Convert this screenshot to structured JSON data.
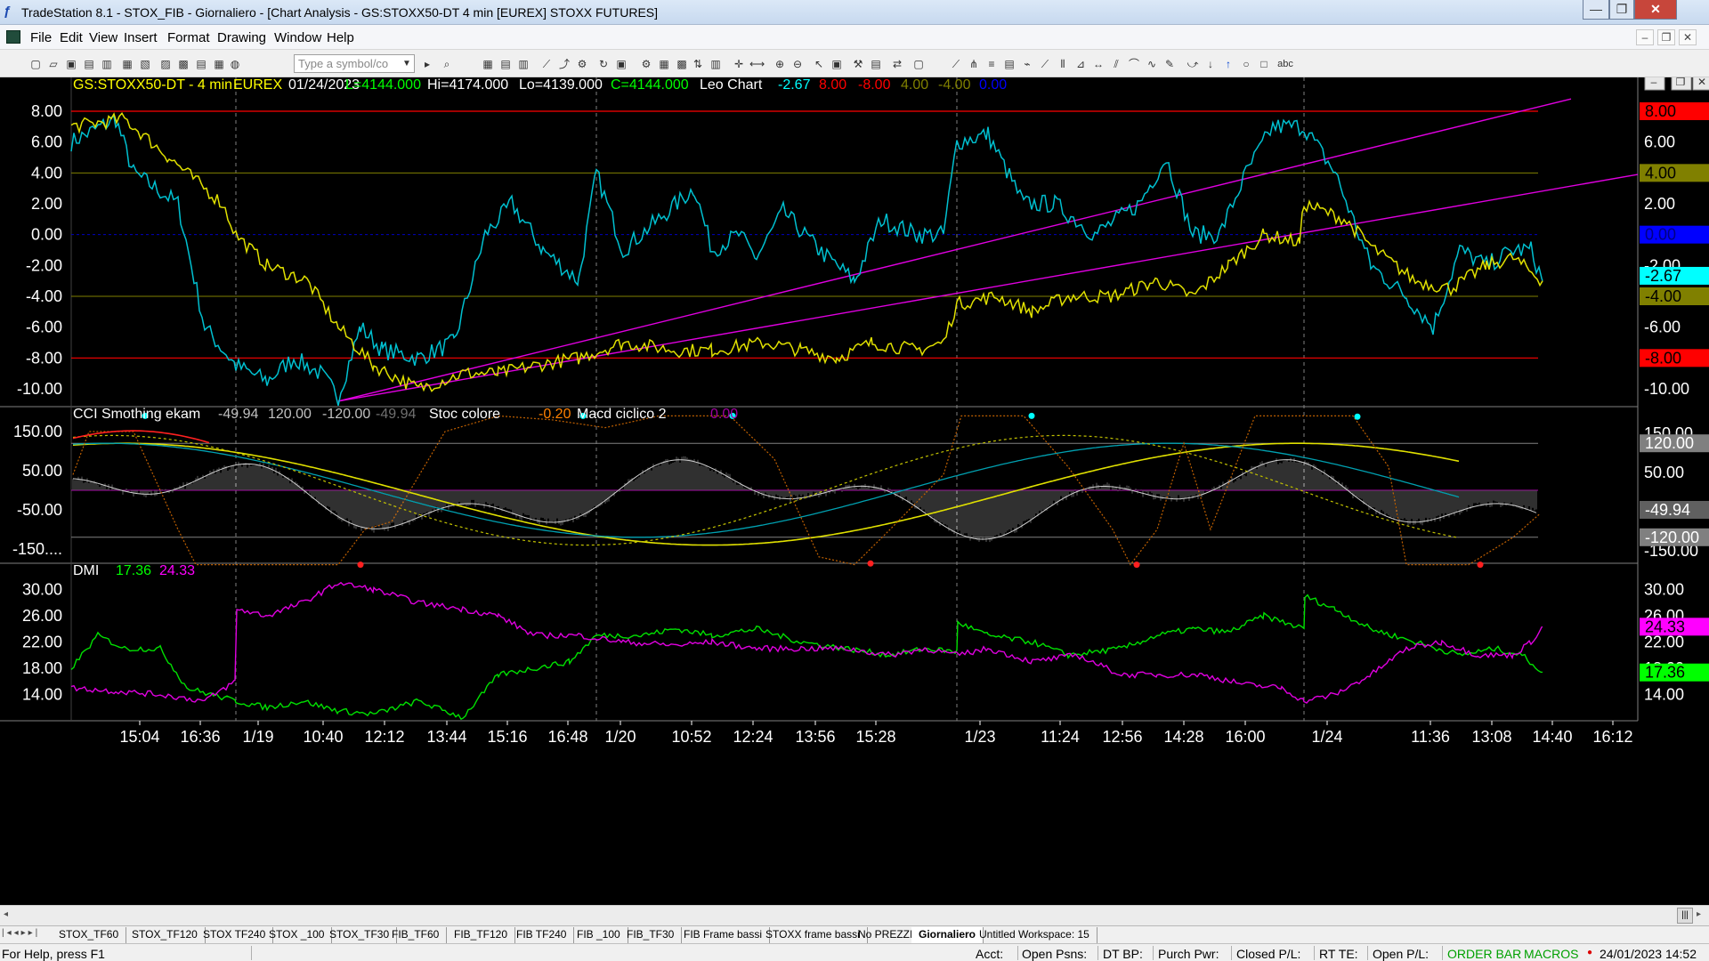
{
  "window": {
    "title": "TradeStation 8.1 - STOX_FIB - Giornaliero - [Chart Analysis - GS:STOXX50-DT  4 min  [EUREX] STOXX FUTURES]",
    "min": "—",
    "max": "❐",
    "close": "✕"
  },
  "menu": [
    "File",
    "Edit",
    "View",
    "Insert",
    "Format",
    "Drawing",
    "Window",
    "Help"
  ],
  "toolbar": {
    "symbol_placeholder": "Type a symbol/co"
  },
  "price_header": {
    "symbol": "GS:STOXX50-DT - 4 min",
    "exchange": "EUREX",
    "date": "01/24/2023",
    "last": "L=4144.000",
    "high": "Hi=4174.000",
    "low": "Lo=4139.000",
    "close": "C=4144.000",
    "study": "Leo Chart",
    "v1": "-2.67",
    "v2": "8.00",
    "v3": "-8.00",
    "v4": "4.00",
    "v5": "-4.00",
    "v6": "0.00"
  },
  "cci_header": {
    "name": "CCI Smothing ekam",
    "v1": "-49.94",
    "v2": "120.00",
    "v3": "-120.00",
    "v4": "-49.94",
    "stoc": "Stoc colore",
    "stoc_v": "-0.20",
    "macd": "Macd ciclico 2",
    "macd_v": "0.00"
  },
  "dmi_header": {
    "name": "DMI",
    "v1": "17.36",
    "v2": "24.33"
  },
  "panel1_left_ticks": [
    "8.00",
    "6.00",
    "4.00",
    "2.00",
    "0.00",
    "-2.00",
    "-4.00",
    "-6.00",
    "-8.00",
    "-10.00"
  ],
  "panel1_right_ticks": [
    "8.00",
    "6.00",
    "4.00",
    "2.00",
    "0.00",
    "-2.00",
    "-4.00",
    "-6.00",
    "-8.00",
    "-10.00"
  ],
  "panel1_right_labels": [
    {
      "text": "8.00",
      "color": "#ff0000",
      "fg": "#000000"
    },
    {
      "text": "4.00",
      "color": "#808000",
      "fg": "#000000"
    },
    {
      "text": "0.00",
      "color": "#0000ff",
      "fg": "#000080"
    },
    {
      "text": "-2.67",
      "color": "#00ffff",
      "fg": "#000000"
    },
    {
      "text": "-4.00",
      "color": "#808000",
      "fg": "#000000"
    },
    {
      "text": "-8.00",
      "color": "#ff0000",
      "fg": "#000000"
    }
  ],
  "panel2_left_ticks": [
    "150.00",
    "50.00",
    "-50.00",
    "-150...."
  ],
  "panel2_right_ticks": [
    "150.00",
    "50.00",
    "-150.00"
  ],
  "panel2_right_labels": [
    {
      "text": "120.00",
      "color": "#808080",
      "fg": "#ffffff"
    },
    {
      "text": "-49.94",
      "color": "#606060",
      "fg": "#ffffff"
    },
    {
      "text": "-120.00",
      "color": "#808080",
      "fg": "#ffffff"
    }
  ],
  "panel3_left_ticks": [
    "30.00",
    "26.00",
    "22.00",
    "18.00",
    "14.00"
  ],
  "panel3_right_ticks": [
    "30.00",
    "26.00",
    "22.00",
    "18.00",
    "14.00"
  ],
  "panel3_right_labels": [
    {
      "text": "24.33",
      "color": "#ff00ff",
      "fg": "#000000"
    },
    {
      "text": "17.36",
      "color": "#00ff00",
      "fg": "#000000"
    }
  ],
  "time_axis": [
    "15:04",
    "16:36",
    "1/19",
    "10:40",
    "12:12",
    "13:44",
    "15:16",
    "16:48",
    "1/20",
    "10:52",
    "12:24",
    "13:56",
    "15:28",
    "1/23",
    "11:24",
    "12:56",
    "14:28",
    "16:00",
    "1/24",
    "11:36",
    "13:08",
    "14:40",
    "16:12"
  ],
  "colors": {
    "cci_cyan": "#00c0d0",
    "cci_yellow": "#e0e000",
    "trend": "#e000e0",
    "red_line": "#ff0000",
    "olive_line": "#808000",
    "blue_line": "#0000c0",
    "dmi_green": "#00e000",
    "dmi_magenta": "#e000e0"
  },
  "sheets": [
    "STOX_TF60",
    "STOX_TF120",
    "STOX TF240",
    "STOX _100",
    "STOX_TF30",
    "FIB_TF60",
    "FIB_TF120",
    "FIB TF240",
    "FIB _100",
    "FIB_TF30",
    "FIB Frame bassi",
    "STOXX frame bassi",
    "No PREZZI",
    "Giornaliero",
    "Untitled Workspace: 15"
  ],
  "status": {
    "help": "For Help, press F1",
    "acct": "Acct:",
    "open_psns": "Open Psns:",
    "dt_bp": "DT BP:",
    "purch_pwr": "Purch Pwr:",
    "closed_pl": "Closed P/L:",
    "rt_te": "RT TE:",
    "open_pl": "Open P/L:",
    "order_bar": "ORDER BAR",
    "macros": "MACROS",
    "datetime": "24/01/2023 14:52"
  }
}
